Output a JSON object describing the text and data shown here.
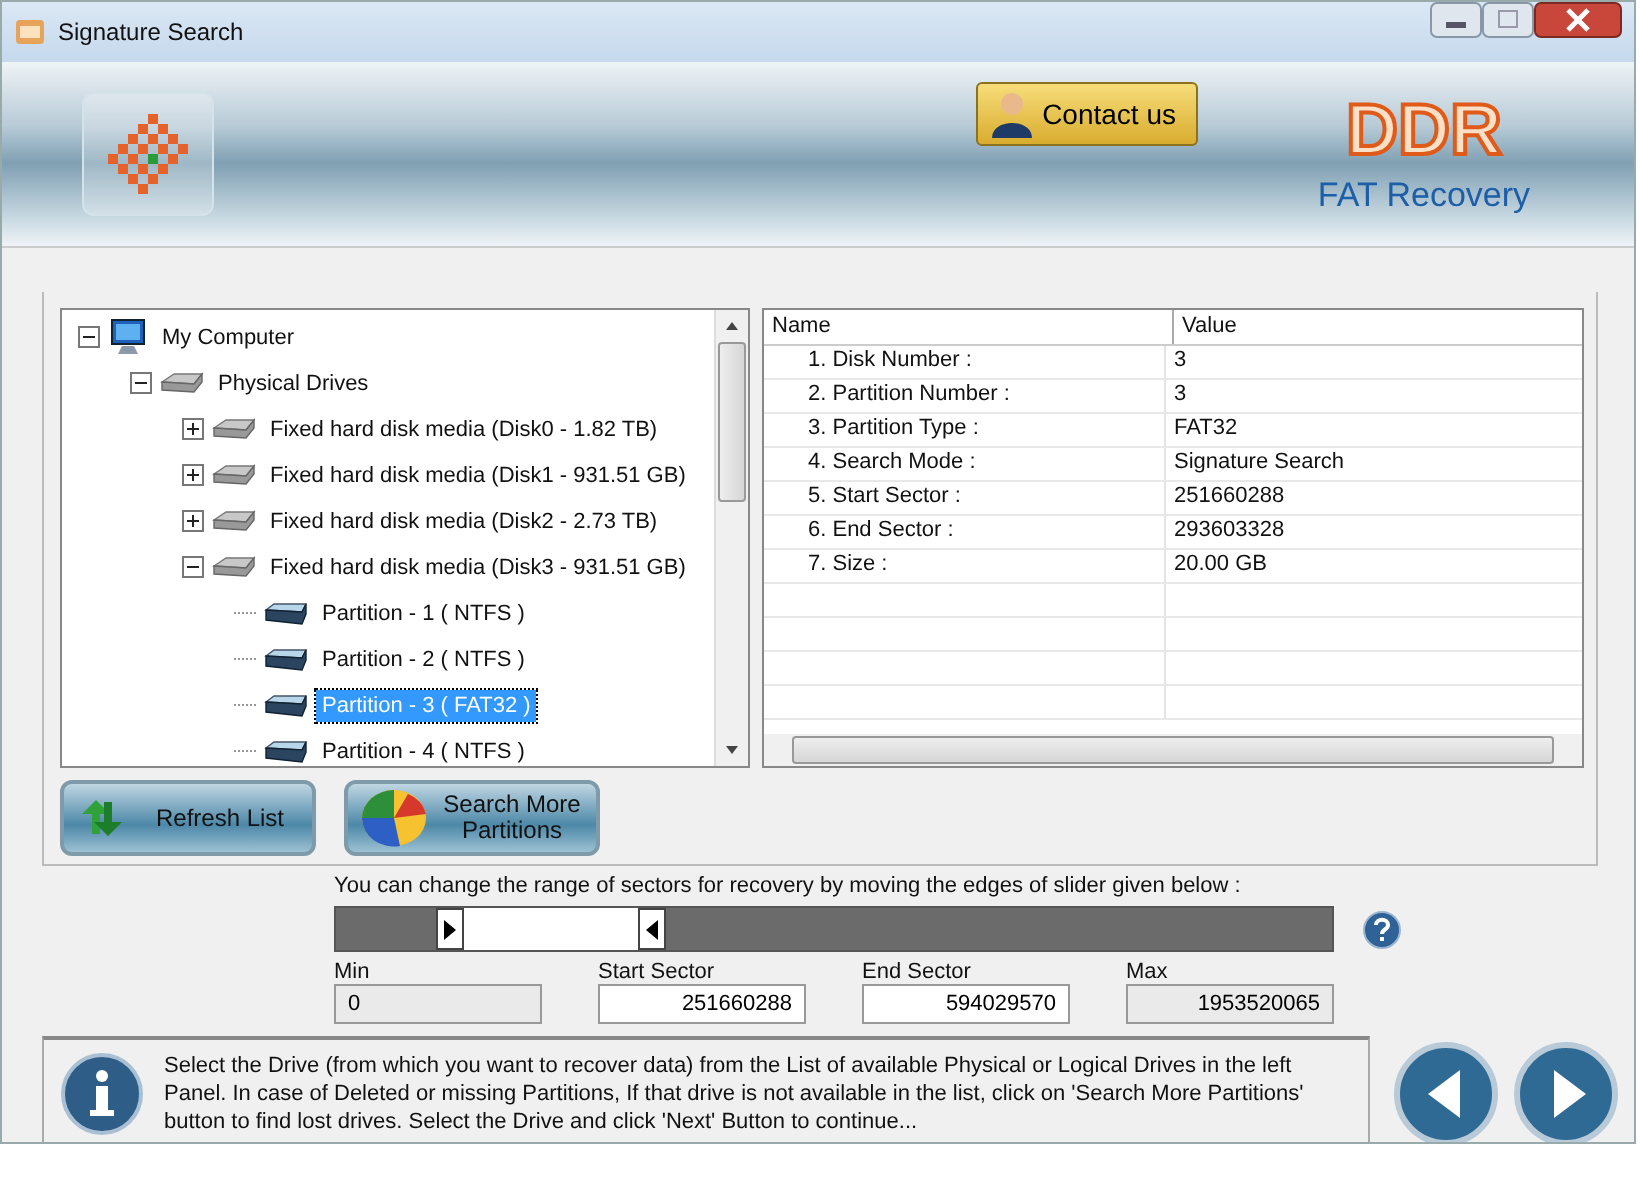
{
  "window": {
    "title": "Signature Search"
  },
  "header": {
    "contact_button": "Contact us",
    "brand": "DDR",
    "product": "FAT Recovery"
  },
  "tree": [
    {
      "kind": "computer",
      "label": "My Computer",
      "expanded": true,
      "selected": false,
      "children": [
        {
          "kind": "drives",
          "label": "Physical Drives",
          "expanded": true,
          "selected": false,
          "children": [
            {
              "kind": "disk",
              "label": "Fixed hard disk media (Disk0 - 1.82 TB)",
              "expanded": false,
              "selected": false
            },
            {
              "kind": "disk",
              "label": "Fixed hard disk media (Disk1 - 931.51 GB)",
              "expanded": false,
              "selected": false
            },
            {
              "kind": "disk",
              "label": "Fixed hard disk media (Disk2 - 2.73 TB)",
              "expanded": false,
              "selected": false
            },
            {
              "kind": "disk",
              "label": "Fixed hard disk media (Disk3 - 931.51 GB)",
              "expanded": true,
              "selected": false,
              "children": [
                {
                  "kind": "partition",
                  "label": "Partition - 1 ( NTFS )",
                  "selected": false
                },
                {
                  "kind": "partition",
                  "label": "Partition - 2 ( NTFS )",
                  "selected": false
                },
                {
                  "kind": "partition",
                  "label": "Partition - 3 ( FAT32 )",
                  "selected": true
                },
                {
                  "kind": "partition",
                  "label": "Partition - 4 ( NTFS )",
                  "selected": false
                }
              ]
            }
          ]
        }
      ]
    }
  ],
  "details": {
    "columns": [
      "Name",
      "Value"
    ],
    "rows": [
      [
        "1. Disk Number :",
        "3"
      ],
      [
        "2. Partition Number :",
        "3"
      ],
      [
        "3. Partition Type :",
        "FAT32"
      ],
      [
        "4. Search Mode :",
        "Signature Search"
      ],
      [
        "5. Start Sector :",
        "251660288"
      ],
      [
        "6. End Sector :",
        "293603328"
      ],
      [
        "7. Size :",
        "20.00 GB"
      ]
    ]
  },
  "buttons": [
    {
      "kind": "refresh",
      "label": "Refresh List"
    },
    {
      "kind": "search",
      "label": "Search More Partitions"
    }
  ],
  "slider": {
    "instruction": "You can change the range of sectors for recovery by moving the edges of slider given below :",
    "handles": [
      {
        "kind": "start",
        "level": 0.129
      },
      {
        "kind": "end",
        "level": 0.304
      }
    ]
  },
  "fields": [
    {
      "label": "Min",
      "value": "0",
      "disabled": true
    },
    {
      "label": "Start Sector",
      "value": "251660288",
      "disabled": false
    },
    {
      "label": "End Sector",
      "value": "594029570",
      "disabled": false
    },
    {
      "label": "Max",
      "value": "1953520065",
      "disabled": true
    }
  ],
  "info": "Select the Drive (from which you want to recover data) from the List of available Physical or Logical Drives in the left Panel. In case of Deleted or missing Partitions, If that drive is not available in the list, click on 'Search More Partitions' button to find lost drives. Select the Drive and click 'Next' Button to continue...",
  "nav_buttons": [
    {
      "kind": "back"
    },
    {
      "kind": "next"
    }
  ]
}
